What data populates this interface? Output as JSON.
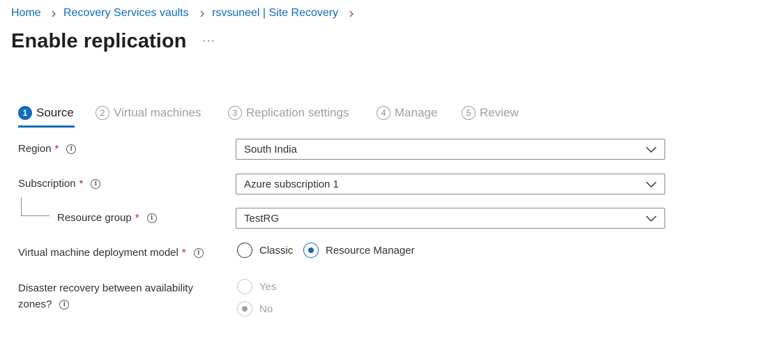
{
  "breadcrumb": {
    "items": [
      "Home",
      "Recovery Services vaults",
      "rsvsuneel | Site Recovery"
    ]
  },
  "page": {
    "title": "Enable replication",
    "more_label": "···"
  },
  "steps": [
    {
      "number": "1",
      "label": "Source",
      "active": true
    },
    {
      "number": "2",
      "label": "Virtual machines",
      "active": false
    },
    {
      "number": "3",
      "label": "Replication settings",
      "active": false
    },
    {
      "number": "4",
      "label": "Manage",
      "active": false
    },
    {
      "number": "5",
      "label": "Review",
      "active": false
    }
  ],
  "form": {
    "required_marker": "*",
    "info_glyph": "i",
    "region": {
      "label": "Region",
      "value": "South India"
    },
    "subscription": {
      "label": "Subscription",
      "value": "Azure subscription 1"
    },
    "resource_group": {
      "label": "Resource group",
      "value": "TestRG"
    },
    "deployment_model": {
      "label": "Virtual machine deployment model",
      "options": [
        "Classic",
        "Resource Manager"
      ],
      "selected": "Resource Manager"
    },
    "availability_zones": {
      "label_line1": "Disaster recovery between availability",
      "label_line2": "zones?",
      "options": [
        "Yes",
        "No"
      ],
      "selected": "No",
      "disabled": true
    }
  },
  "colors": {
    "accent": "#0f6cbd",
    "required": "#a4262c",
    "disabled_text": "#a19f9d"
  },
  "icons": {
    "breadcrumb_separator": "chevron-right-icon",
    "dropdown": "chevron-down-icon",
    "info": "info-icon"
  }
}
